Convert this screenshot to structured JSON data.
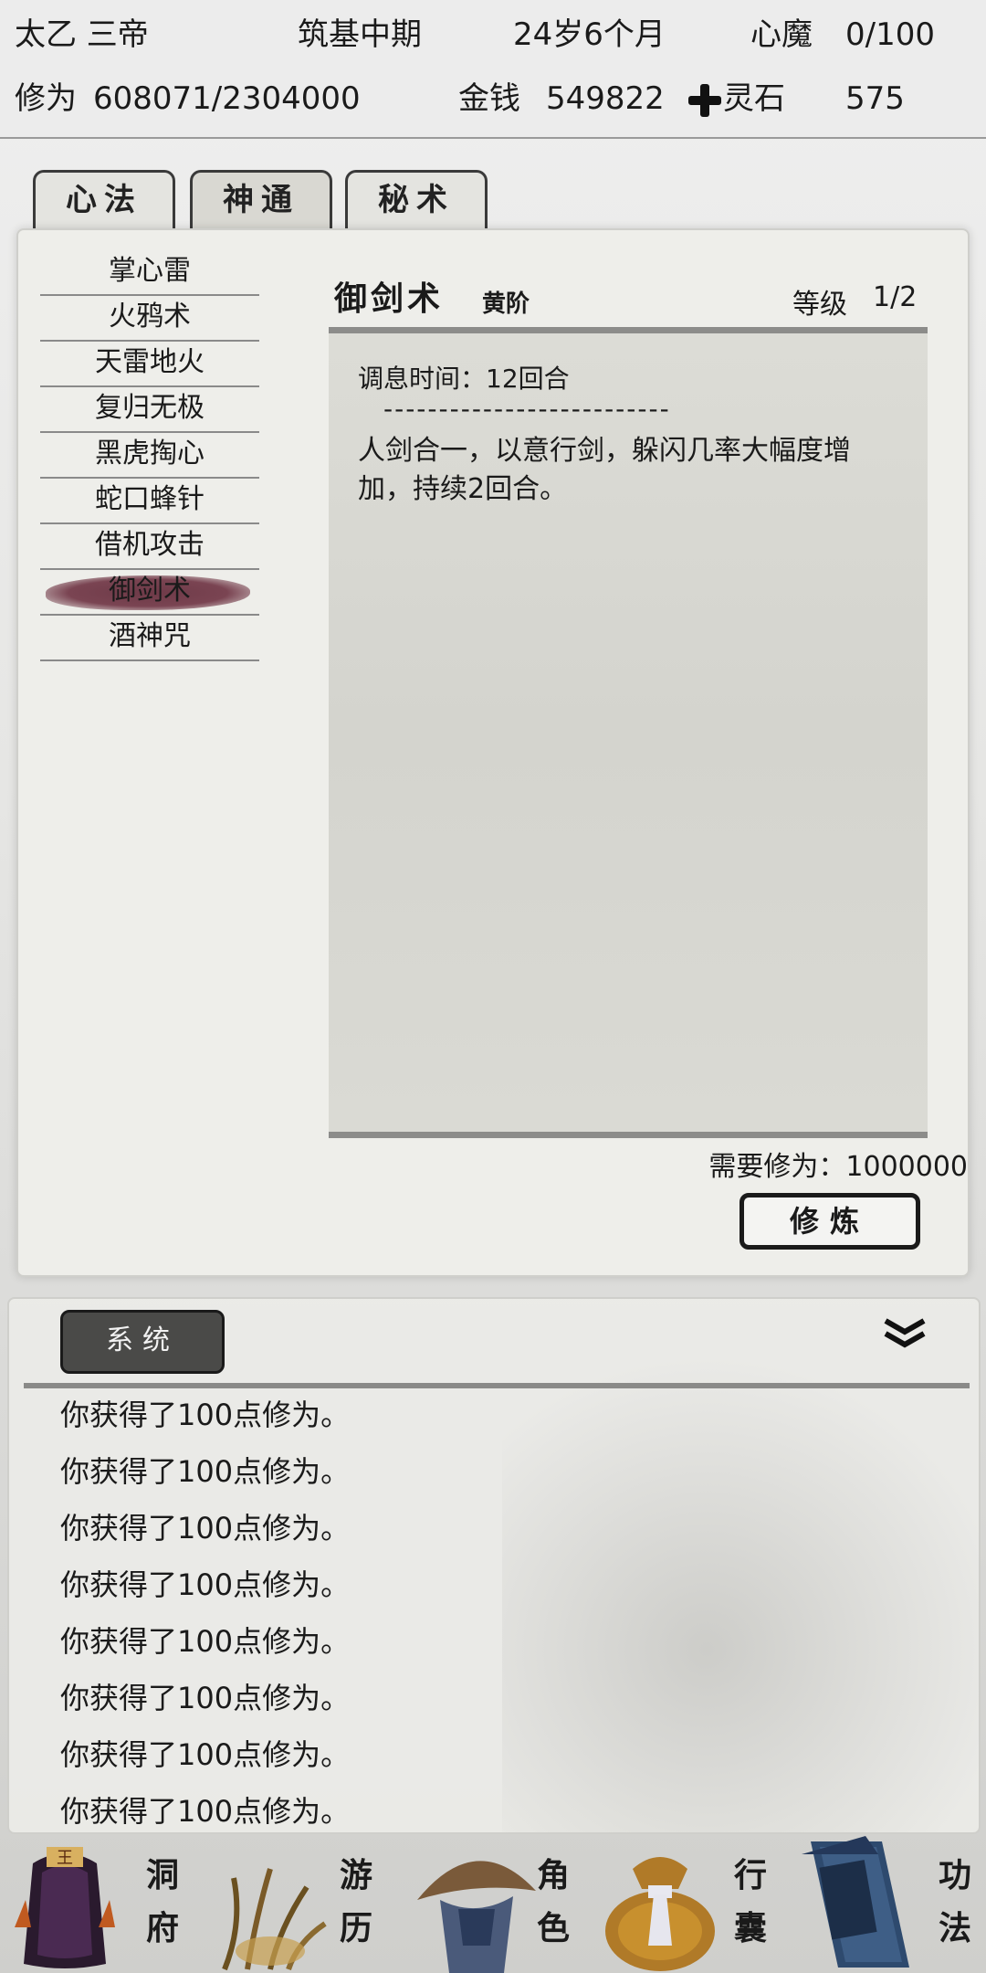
{
  "header": {
    "name": "太乙 三帝",
    "realm": "筑基中期",
    "age": "24岁6个月",
    "heart_demon_label": "心魔",
    "heart_demon_value": "0/100",
    "cultivation_label": "修为",
    "cultivation_value": "608071/2304000",
    "money_label": "金钱",
    "money_value": "549822",
    "spirit_stone_label": "灵石",
    "spirit_stone_value": "575"
  },
  "tabs": [
    {
      "label": "心法",
      "active": false
    },
    {
      "label": "神通",
      "active": true
    },
    {
      "label": "秘术",
      "active": false
    }
  ],
  "skills": [
    {
      "label": "掌心雷"
    },
    {
      "label": "火鸦术"
    },
    {
      "label": "天雷地火"
    },
    {
      "label": "复归无极"
    },
    {
      "label": "黑虎掏心"
    },
    {
      "label": "蛇口蜂针"
    },
    {
      "label": "借机攻击"
    },
    {
      "label": "御剑术",
      "selected": true
    },
    {
      "label": "酒神咒"
    }
  ],
  "detail": {
    "title": "御剑术",
    "grade": "黄阶",
    "level_label": "等级",
    "level_value": "1/2",
    "cooldown": "调息时间：12回合",
    "separator": "--------------------------",
    "effect": "人剑合一，以意行剑，躲闪几率大幅度增加，持续2回合。",
    "requirement": "需要修为：1000000",
    "train_button": "修炼"
  },
  "log": {
    "tab_label": "系统",
    "lines": [
      "你获得了100点修为。",
      "你获得了100点修为。",
      "你获得了100点修为。",
      "你获得了100点修为。",
      "你获得了100点修为。",
      "你获得了100点修为。",
      "你获得了100点修为。",
      "你获得了100点修为。"
    ]
  },
  "nav": [
    {
      "label": "洞府",
      "icon": "cave-dwelling-icon"
    },
    {
      "label": "游历",
      "icon": "travel-grass-icon"
    },
    {
      "label": "角色",
      "icon": "character-hat-icon"
    },
    {
      "label": "行囊",
      "icon": "bag-icon"
    },
    {
      "label": "功法",
      "icon": "scroll-book-icon"
    }
  ],
  "colors": {
    "selected_brush": "#7a4452",
    "panel_bg": "#eeeeea",
    "header_bg": "#ececec"
  }
}
